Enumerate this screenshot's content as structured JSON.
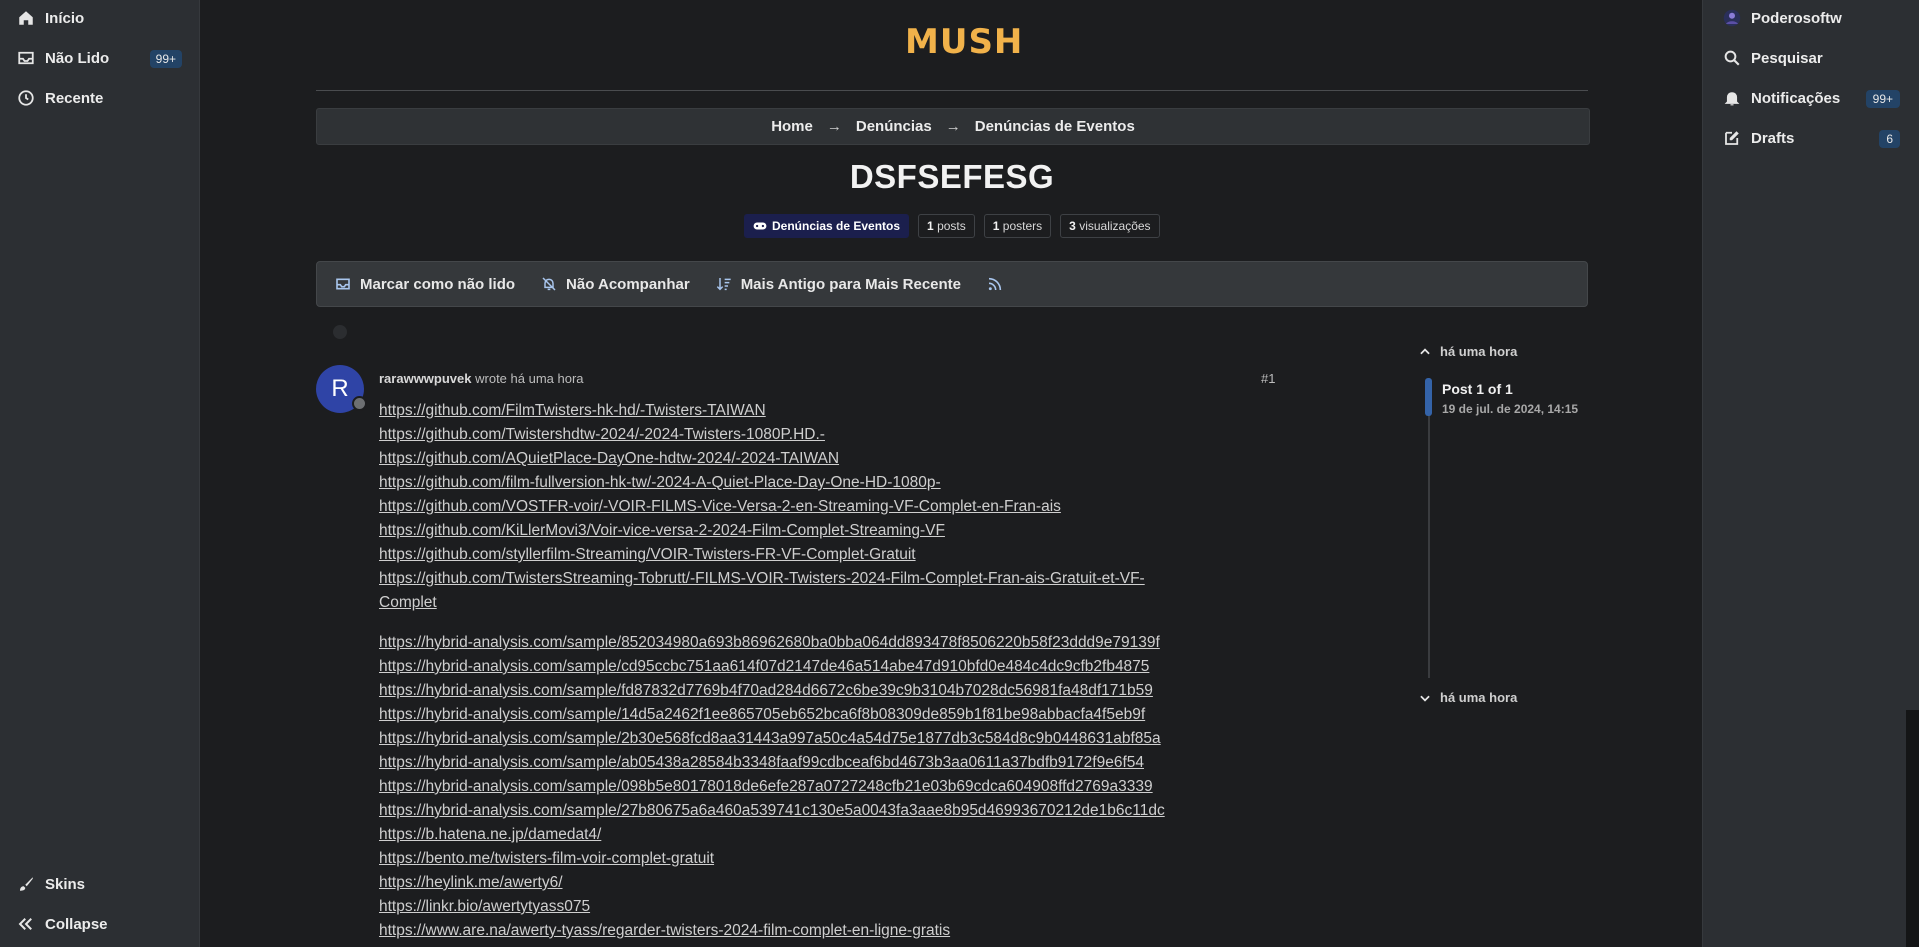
{
  "left_nav": {
    "items": [
      {
        "label": "Início",
        "icon": "home-icon"
      },
      {
        "label": "Não Lido",
        "icon": "inbox-icon",
        "badge": "99+"
      },
      {
        "label": "Recente",
        "icon": "clock-icon"
      }
    ],
    "bottom": [
      {
        "label": "Skins",
        "icon": "brush-icon"
      },
      {
        "label": "Collapse",
        "icon": "double-chevron-left-icon"
      }
    ]
  },
  "right_nav": {
    "items": [
      {
        "label": "Poderosoftw",
        "icon": "avatar-icon"
      },
      {
        "label": "Pesquisar",
        "icon": "search-icon"
      },
      {
        "label": "Notificações",
        "icon": "bell-icon",
        "badge": "99+"
      },
      {
        "label": "Drafts",
        "icon": "edit-icon",
        "badge": "6"
      }
    ]
  },
  "site": {
    "logo": "MUSH"
  },
  "breadcrumb": {
    "items": [
      "Home",
      "Denúncias",
      "Denúncias de Eventos"
    ],
    "separator": "→"
  },
  "topic": {
    "title": "DSFSEFESG",
    "category": "Denúncias de Eventos",
    "stats": [
      {
        "count": "1",
        "label": "posts"
      },
      {
        "count": "1",
        "label": "posters"
      },
      {
        "count": "3",
        "label": "visualizações"
      }
    ]
  },
  "actions": [
    {
      "label": "Marcar como não lido",
      "icon": "inbox-icon"
    },
    {
      "label": "Não Acompanhar",
      "icon": "bell-off-icon"
    },
    {
      "label": "Mais Antigo para Mais Recente",
      "icon": "sort-icon"
    },
    {
      "label": "",
      "icon": "rss-icon"
    }
  ],
  "post": {
    "avatar_letter": "R",
    "author": "rarawwwpuvek",
    "wrote": "wrote há uma hora",
    "number": "#1",
    "links_group1": [
      "https://github.com/FilmTwisters-hk-hd/-Twisters-TAIWAN",
      "https://github.com/Twistershdtw-2024/-2024-Twisters-1080P.HD.-",
      "https://github.com/AQuietPlace-DayOne-hdtw-2024/-2024-TAIWAN",
      "https://github.com/film-fullversion-hk-tw/-2024-A-Quiet-Place-Day-One-HD-1080p-",
      "https://github.com/VOSTFR-voir/-VOIR-FILMS-Vice-Versa-2-en-Streaming-VF-Complet-en-Fran-ais",
      "https://github.com/KiLlerMovi3/Voir-vice-versa-2-2024-Film-Complet-Streaming-VF",
      "https://github.com/styllerfilm-Streaming/VOIR-Twisters-FR-VF-Complet-Gratuit",
      "https://github.com/TwistersStreaming-Tobrutt/-FILMS-VOIR-Twisters-2024-Film-Complet-Fran-ais-Gratuit-et-VF-",
      "Complet"
    ],
    "links_group2": [
      "https://hybrid-analysis.com/sample/852034980a693b86962680ba0bba064dd893478f8506220b58f23ddd9e79139f",
      "https://hybrid-analysis.com/sample/cd95ccbc751aa614f07d2147de46a514abe47d910bfd0e484c4dc9cfb2fb4875",
      "https://hybrid-analysis.com/sample/fd87832d7769b4f70ad284d6672c6be39c9b3104b7028dc56981fa48df171b59",
      "https://hybrid-analysis.com/sample/14d5a2462f1ee865705eb652bca6f8b08309de859b1f81be98abbacfa4f5eb9f",
      "https://hybrid-analysis.com/sample/2b30e568fcd8aa31443a997a50c4a54d75e1877db3c584d8c9b0448631abf85a",
      "https://hybrid-analysis.com/sample/ab05438a28584b3348faaf99cdbceaf6bd4673b3aa0611a37bdfb9172f9e6f54",
      "https://hybrid-analysis.com/sample/098b5e80178018de6efe287a0727248cfb21e03b69cdca604908ffd2769a3339",
      "https://hybrid-analysis.com/sample/27b80675a6a460a539741c130e5a0043fa3aae8b95d46993670212de1b6c11dc",
      "https://b.hatena.ne.jp/damedat4/",
      "https://bento.me/twisters-film-voir-complet-gratuit",
      "https://heylink.me/awerty6/",
      "https://linkr.bio/awertytyass075",
      "https://www.are.na/awerty-tyass/regarder-twisters-2024-film-complet-en-ligne-gratis"
    ]
  },
  "timeline": {
    "top_label": "há uma hora",
    "position": "Post 1 of 1",
    "date": "19 de jul. de 2024, 14:15",
    "bottom_label": "há uma hora"
  },
  "colors": {
    "accent": "#f1b24a",
    "badge": "#234366",
    "category": "#1b1f4d",
    "avatar": "#2f44a6"
  }
}
